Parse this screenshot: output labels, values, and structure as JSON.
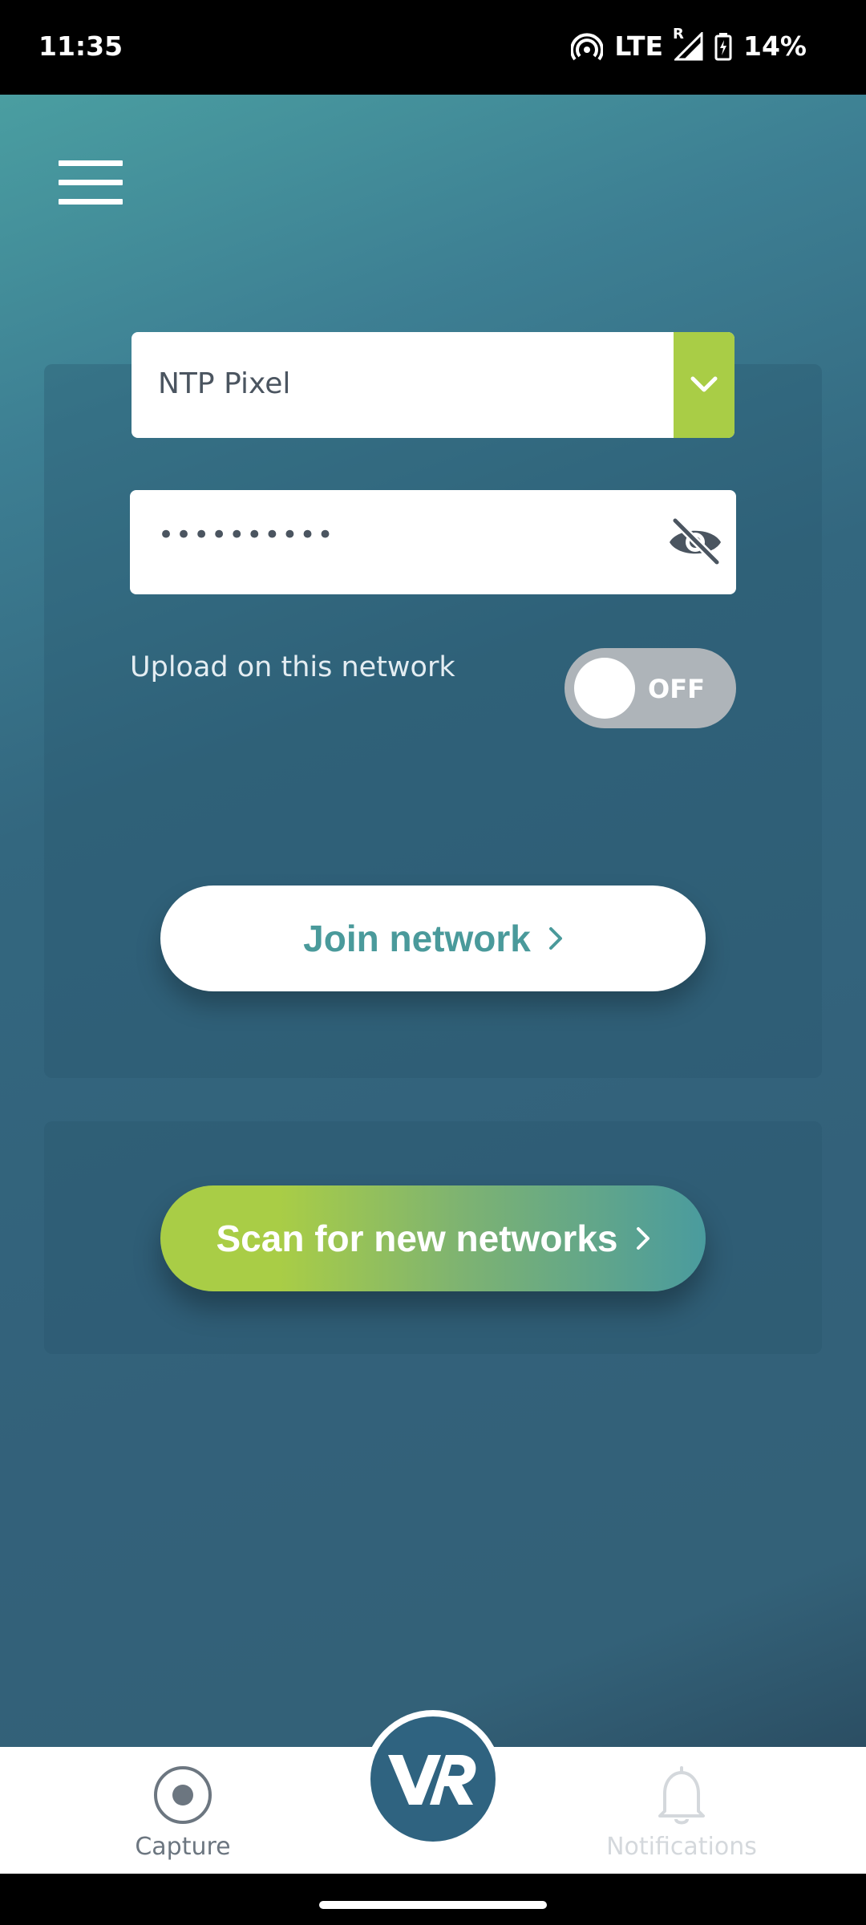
{
  "status_bar": {
    "time": "11:35",
    "network": "LTE",
    "roaming": "R",
    "battery": "14%"
  },
  "network_form": {
    "selected_network": "NTP Pixel",
    "password_value": "••••••••••",
    "upload_label": "Upload on this network",
    "upload_toggle_state": "OFF",
    "join_button": "Join network",
    "scan_button": "Scan for new networks"
  },
  "bottom_nav": {
    "capture_label": "Capture",
    "notifications_label": "Notifications"
  },
  "colors": {
    "accent_green": "#a9cd46",
    "teal": "#4a9a9b",
    "dark_blue": "#2f6380"
  },
  "icons": [
    "menu-icon",
    "chevron-down-icon",
    "eye-off-icon",
    "chevron-right-icon",
    "record-icon",
    "bell-icon",
    "vr-logo"
  ]
}
